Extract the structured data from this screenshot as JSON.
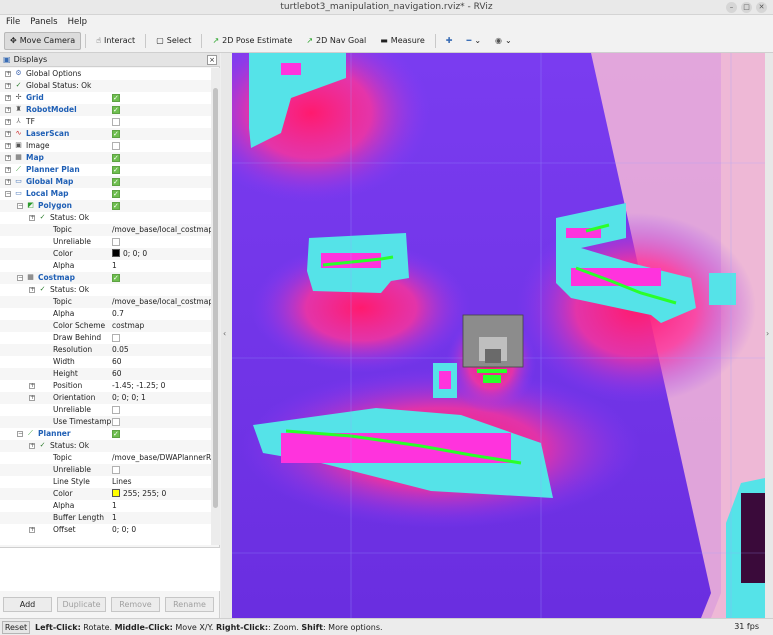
{
  "window": {
    "title": "turtlebot3_manipulation_navigation.rviz* - RViz"
  },
  "menu": [
    "File",
    "Panels",
    "Help"
  ],
  "toolbar": [
    {
      "label": "Move Camera",
      "icon": "move-camera-icon",
      "glyph": "✥"
    },
    {
      "label": "Interact",
      "icon": "hand-icon",
      "glyph": "☝"
    },
    {
      "label": "Select",
      "icon": "select-icon",
      "glyph": "▢"
    },
    {
      "label": "2D Pose Estimate",
      "icon": "pose-arrow-icon",
      "glyph": "↗"
    },
    {
      "label": "2D Nav Goal",
      "icon": "goal-arrow-icon",
      "glyph": "↗"
    },
    {
      "label": "Measure",
      "icon": "ruler-icon",
      "glyph": "▬"
    }
  ],
  "panel": {
    "title": "Displays"
  },
  "displays": [
    {
      "indent": 0,
      "exp": "+",
      "icon": "⚙",
      "color": "#4a6fb5",
      "name": "Global Options",
      "bold": false,
      "cb": null,
      "val": ""
    },
    {
      "indent": 0,
      "exp": "+",
      "icon": "✓",
      "color": "#2a7a2a",
      "name": "Global Status: Ok",
      "bold": false,
      "cb": null,
      "val": ""
    },
    {
      "indent": 0,
      "exp": "+",
      "icon": "✢",
      "color": "#5a5a5a",
      "name": "Grid",
      "bold": true,
      "cb": true,
      "val": ""
    },
    {
      "indent": 0,
      "exp": "+",
      "icon": "♜",
      "color": "#555",
      "name": "RobotModel",
      "bold": true,
      "cb": true,
      "val": ""
    },
    {
      "indent": 0,
      "exp": "+",
      "icon": "⅄",
      "color": "#777",
      "name": "TF",
      "bold": false,
      "cb": false,
      "val": ""
    },
    {
      "indent": 0,
      "exp": "+",
      "icon": "∿",
      "color": "#c22",
      "name": "LaserScan",
      "bold": true,
      "cb": true,
      "val": ""
    },
    {
      "indent": 0,
      "exp": "+",
      "icon": "▣",
      "color": "#555",
      "name": "Image",
      "bold": false,
      "cb": false,
      "val": ""
    },
    {
      "indent": 0,
      "exp": "+",
      "icon": "▦",
      "color": "#555",
      "name": "Map",
      "bold": true,
      "cb": true,
      "val": ""
    },
    {
      "indent": 0,
      "exp": "+",
      "icon": "⟋",
      "color": "#2a9a2a",
      "name": "Planner Plan",
      "bold": true,
      "cb": true,
      "val": ""
    },
    {
      "indent": 0,
      "exp": "+",
      "icon": "▭",
      "color": "#3a6db5",
      "name": "Global Map",
      "bold": true,
      "cb": true,
      "val": ""
    },
    {
      "indent": 0,
      "exp": "−",
      "icon": "▭",
      "color": "#3a6db5",
      "name": "Local Map",
      "bold": true,
      "cb": true,
      "val": ""
    },
    {
      "indent": 1,
      "exp": "−",
      "icon": "◩",
      "color": "#2a9a2a",
      "name": "Polygon",
      "bold": true,
      "cb": true,
      "val": ""
    },
    {
      "indent": 2,
      "exp": "+",
      "icon": "✓",
      "color": "#2a7a2a",
      "name": "Status: Ok",
      "bold": false,
      "cb": null,
      "val": ""
    },
    {
      "indent": 2,
      "exp": "",
      "icon": "",
      "color": "",
      "name": "Topic",
      "bold": false,
      "cb": null,
      "val": "/move_base/local_costmap..."
    },
    {
      "indent": 2,
      "exp": "",
      "icon": "",
      "color": "",
      "name": "Unreliable",
      "bold": false,
      "cb": false,
      "val": ""
    },
    {
      "indent": 2,
      "exp": "",
      "icon": "",
      "color": "",
      "name": "Color",
      "bold": false,
      "cb": null,
      "val": "0; 0; 0",
      "swatch": "#000000"
    },
    {
      "indent": 2,
      "exp": "",
      "icon": "",
      "color": "",
      "name": "Alpha",
      "bold": false,
      "cb": null,
      "val": "1"
    },
    {
      "indent": 1,
      "exp": "−",
      "icon": "▦",
      "color": "#555",
      "name": "Costmap",
      "bold": true,
      "cb": true,
      "val": ""
    },
    {
      "indent": 2,
      "exp": "+",
      "icon": "✓",
      "color": "#2a7a2a",
      "name": "Status: Ok",
      "bold": false,
      "cb": null,
      "val": ""
    },
    {
      "indent": 2,
      "exp": "",
      "icon": "",
      "color": "",
      "name": "Topic",
      "bold": false,
      "cb": null,
      "val": "/move_base/local_costmap..."
    },
    {
      "indent": 2,
      "exp": "",
      "icon": "",
      "color": "",
      "name": "Alpha",
      "bold": false,
      "cb": null,
      "val": "0.7"
    },
    {
      "indent": 2,
      "exp": "",
      "icon": "",
      "color": "",
      "name": "Color Scheme",
      "bold": false,
      "cb": null,
      "val": "costmap"
    },
    {
      "indent": 2,
      "exp": "",
      "icon": "",
      "color": "",
      "name": "Draw Behind",
      "bold": false,
      "cb": false,
      "val": ""
    },
    {
      "indent": 2,
      "exp": "",
      "icon": "",
      "color": "",
      "name": "Resolution",
      "bold": false,
      "cb": null,
      "val": "0.05"
    },
    {
      "indent": 2,
      "exp": "",
      "icon": "",
      "color": "",
      "name": "Width",
      "bold": false,
      "cb": null,
      "val": "60"
    },
    {
      "indent": 2,
      "exp": "",
      "icon": "",
      "color": "",
      "name": "Height",
      "bold": false,
      "cb": null,
      "val": "60"
    },
    {
      "indent": 2,
      "exp": "+",
      "icon": "",
      "color": "",
      "name": "Position",
      "bold": false,
      "cb": null,
      "val": "-1.45; -1.25; 0"
    },
    {
      "indent": 2,
      "exp": "+",
      "icon": "",
      "color": "",
      "name": "Orientation",
      "bold": false,
      "cb": null,
      "val": "0; 0; 0; 1"
    },
    {
      "indent": 2,
      "exp": "",
      "icon": "",
      "color": "",
      "name": "Unreliable",
      "bold": false,
      "cb": false,
      "val": ""
    },
    {
      "indent": 2,
      "exp": "",
      "icon": "",
      "color": "",
      "name": "Use Timestamp",
      "bold": false,
      "cb": false,
      "val": ""
    },
    {
      "indent": 1,
      "exp": "−",
      "icon": "⟋",
      "color": "#2a9a2a",
      "name": "Planner",
      "bold": true,
      "cb": true,
      "val": ""
    },
    {
      "indent": 2,
      "exp": "+",
      "icon": "✓",
      "color": "#2a7a2a",
      "name": "Status: Ok",
      "bold": false,
      "cb": null,
      "val": ""
    },
    {
      "indent": 2,
      "exp": "",
      "icon": "",
      "color": "",
      "name": "Topic",
      "bold": false,
      "cb": null,
      "val": "/move_base/DWAPlannerR..."
    },
    {
      "indent": 2,
      "exp": "",
      "icon": "",
      "color": "",
      "name": "Unreliable",
      "bold": false,
      "cb": false,
      "val": ""
    },
    {
      "indent": 2,
      "exp": "",
      "icon": "",
      "color": "",
      "name": "Line Style",
      "bold": false,
      "cb": null,
      "val": "Lines"
    },
    {
      "indent": 2,
      "exp": "",
      "icon": "",
      "color": "",
      "name": "Color",
      "bold": false,
      "cb": null,
      "val": "255; 255; 0",
      "swatch": "#ffff00"
    },
    {
      "indent": 2,
      "exp": "",
      "icon": "",
      "color": "",
      "name": "Alpha",
      "bold": false,
      "cb": null,
      "val": "1"
    },
    {
      "indent": 2,
      "exp": "",
      "icon": "",
      "color": "",
      "name": "Buffer Length",
      "bold": false,
      "cb": null,
      "val": "1"
    },
    {
      "indent": 2,
      "exp": "+",
      "icon": "",
      "color": "",
      "name": "Offset",
      "bold": false,
      "cb": null,
      "val": "0; 0; 0"
    }
  ],
  "buttons": [
    {
      "label": "Add",
      "enabled": true
    },
    {
      "label": "Duplicate",
      "enabled": false
    },
    {
      "label": "Remove",
      "enabled": false
    },
    {
      "label": "Rename",
      "enabled": false
    }
  ],
  "status": {
    "reset": "Reset",
    "hint_parts": [
      {
        "t": "Left-Click:",
        "b": true
      },
      {
        "t": " Rotate. ",
        "b": false
      },
      {
        "t": "Middle-Click:",
        "b": true
      },
      {
        "t": " Move X/Y. ",
        "b": false
      },
      {
        "t": "Right-Click:",
        "b": true
      },
      {
        "t": ": Zoom. ",
        "b": false
      },
      {
        "t": "Shift",
        "b": true
      },
      {
        "t": ": More options.",
        "b": false
      }
    ],
    "fps": "31 fps"
  }
}
